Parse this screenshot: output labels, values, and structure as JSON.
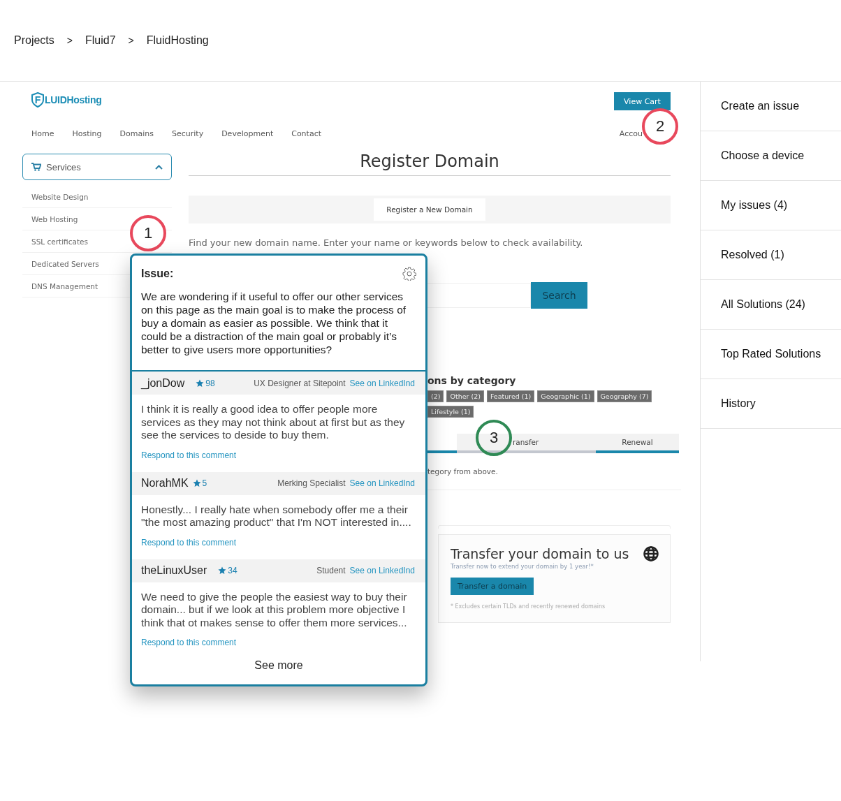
{
  "breadcrumb": [
    {
      "kind": "crumb",
      "label": "Projects"
    },
    {
      "kind": "separator",
      "label": ">"
    },
    {
      "kind": "crumb",
      "label": "Fluid7"
    },
    {
      "kind": "separator",
      "label": ">"
    },
    {
      "kind": "crumb",
      "label": "FluidHosting"
    }
  ],
  "site": {
    "logo_mark": "F",
    "logo_text": "LUIDHosting",
    "cart_button": "View Cart",
    "nav": [
      "Home",
      "Hosting",
      "Domains",
      "Security",
      "Development",
      "Contact"
    ],
    "account_link": "Accou",
    "services_menu": {
      "label": "Services",
      "expanded": true,
      "items": [
        "Website Design",
        "Web Hosting",
        "SSL certificates",
        "Dedicated Servers",
        "DNS Management"
      ]
    },
    "heading": "Register Domain",
    "tabs": [
      {
        "label": "Register a New Domain"
      }
    ],
    "intro": "Find your new domain name. Enter your name or keywords below to check availability.",
    "search_button": "Search",
    "categories": {
      "heading": "ons by category",
      "tags": [
        "(2)",
        "Other (2)",
        "Featured (1)",
        "Geographic (1)",
        "Geography (7)",
        "Lifestyle (1)"
      ]
    },
    "type_tabs": [
      {
        "label": "ransfer",
        "selected": false
      },
      {
        "label": "Renewal",
        "selected": true
      }
    ],
    "hint": "tegory from above.",
    "transfer_card": {
      "title": "Transfer your domain to us",
      "subtitle": "Transfer now to extend your domain by 1 year!*",
      "button": "Transfer a domain",
      "footnote": "* Excludes certain TLDs and recently renewed domains"
    }
  },
  "annotations": [
    {
      "label": "1",
      "color": "#e8485c"
    },
    {
      "label": "2",
      "color": "#e8485c"
    },
    {
      "label": "3",
      "color": "#2f8a55"
    }
  ],
  "issue_popup": {
    "title": "Issue:",
    "text": "We are wondering if it useful to offer our other services on this page as the main goal is to make the process of buy a domain as easier as possible. We think that it could be a distraction of the main goal or probably it’s better to give users more opportunities?",
    "comments": [
      {
        "author": "_jonDow",
        "score": "98",
        "role": "UX Designer at Sitepoint",
        "link": "See on LinkedInd",
        "text": "I think it is really a good idea to offer people more services as they may not think about at first but as they see the services to deside to buy them.",
        "respond": "Respond to this comment"
      },
      {
        "author": "NorahMK",
        "score": "5",
        "role": "Merking Specialist",
        "link": "See on LinkedInd",
        "text": "Honestly... I really hate when somebody offer me a their \"the most amazing product\" that I'm NOT interested in....",
        "respond": "Respond to this comment"
      },
      {
        "author": "theLinuxUser",
        "score": "34",
        "role": "Student",
        "link": "See on LinkedInd",
        "text": "We need to give the people the easiest way to buy their domain... but if we look at this problem more objective I think that ot makes sense to offer them more services...",
        "respond": "Respond to this comment"
      }
    ],
    "see_more": "See more"
  },
  "side_menu": [
    "Create an issue",
    "Choose a device",
    "My issues (4)",
    "Resolved (1)",
    "All Solutions (24)",
    "Top Rated Solutions",
    "History"
  ]
}
